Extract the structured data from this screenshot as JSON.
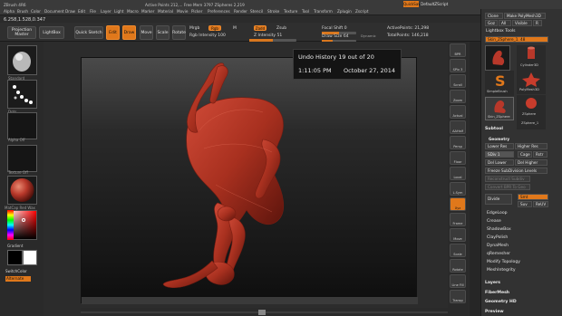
{
  "menubar": {
    "title": "ZBrush 4R6",
    "items": [
      "Alpha",
      "Brush",
      "Color",
      "Document",
      "Draw",
      "Edit",
      "File",
      "Layer",
      "Light",
      "Macro",
      "Marker",
      "Material",
      "Movie",
      "Picker",
      "Preferences",
      "Render",
      "Stencil",
      "Stroke",
      "Texture",
      "Tool",
      "Transform",
      "Zplugin",
      "Zscript"
    ],
    "quicksave": "QuickSave",
    "default_script": "DefaultZScript",
    "status": "Active Points 212,... Free Mem 3797 ZSpheres 2,219"
  },
  "coords": "6.258,1.528,0.347",
  "toolbar": {
    "projection_master": "Projection Master",
    "lightbox": "LightBox",
    "quick_sketch": "Quick Sketch",
    "edit": "Edit",
    "draw": "Draw",
    "move": "Move",
    "scale": "Scale",
    "rotate": "Rotate",
    "mrgb": "Mrgb",
    "rgb": "Rgb",
    "m": "M",
    "rgb_intensity": "Rgb Intensity 100",
    "zadd": "Zadd",
    "zsub": "Zsub",
    "z_intensity": "Z Intensity 51",
    "focal_shift": "Focal Shift 0",
    "draw_size": "Draw Size 64",
    "dynamic": "Dynamic",
    "active_points": "ActivePoints: 21,298",
    "total_points": "TotalPoints: 146,218"
  },
  "left_shelf": {
    "brush_label": "Standard",
    "stroke_label": "Dots",
    "alpha_label": "Alpha Off",
    "texture_label": "Texture Off",
    "material_label": "MatCap Red Wax",
    "gradient": "Gradient",
    "switch_color": "SwitchColor",
    "alternate": "Alternate"
  },
  "undo_tooltip": {
    "title": "Undo History 19 out of 20",
    "time": "1:11:05 PM",
    "date": "October 27, 2014"
  },
  "right_shelf": [
    "BPR",
    "SPix 3",
    "Scroll",
    "Zoom",
    "Actual",
    "AAHalf",
    "Persp",
    "Floor",
    "Local",
    "L.Sym",
    "Xyz",
    "Frame",
    "Move",
    "Scale",
    "Rotate",
    "Line Fill",
    "Transp",
    "Ghost",
    "Solo",
    "Xpose"
  ],
  "tool_panel": {
    "buttons": [
      "Clone",
      "Make PolyMesh3D",
      "Goz",
      "All",
      "Visible",
      "R"
    ],
    "lightbox_tools": "Lightbox Tools",
    "current_tool": "Skin_ZSphere_1. 48",
    "tools": [
      "Cylinder3D",
      "PolyMesh3D",
      "SimpleBrush",
      "ZSphere",
      "Skin_ZSphere",
      "ZSphere_1"
    ],
    "subtool": "Subtool",
    "geometry": "Geometry",
    "lower_res": "Lower Res",
    "higher_res": "Higher Res",
    "sdiv": "SDiv 1",
    "cage": "Cage",
    "rstr": "Rstr",
    "del_lower": "Del Lower",
    "del_higher": "Del Higher",
    "freeze_subdivision": "Freeze SubDivision Levels",
    "reconstruct": "Reconstruct Subdiv",
    "convert_bpr": "Convert BPR To Geo",
    "divide": "Divide",
    "smt": "Smt",
    "suv": "Suv",
    "reuv": "ReUV",
    "list": [
      "EdgeLoop",
      "Crease",
      "ShadowBox",
      "ClayPolish",
      "DynaMesh",
      "qRemesher",
      "Modify Topology",
      "MeshIntegrity"
    ],
    "layers": "Layers",
    "fibermesh": "FiberMesh",
    "geometry_hd": "Geometry HD",
    "preview": "Preview"
  },
  "colors": {
    "accent": "#e0781b",
    "model": "#b8382a"
  }
}
